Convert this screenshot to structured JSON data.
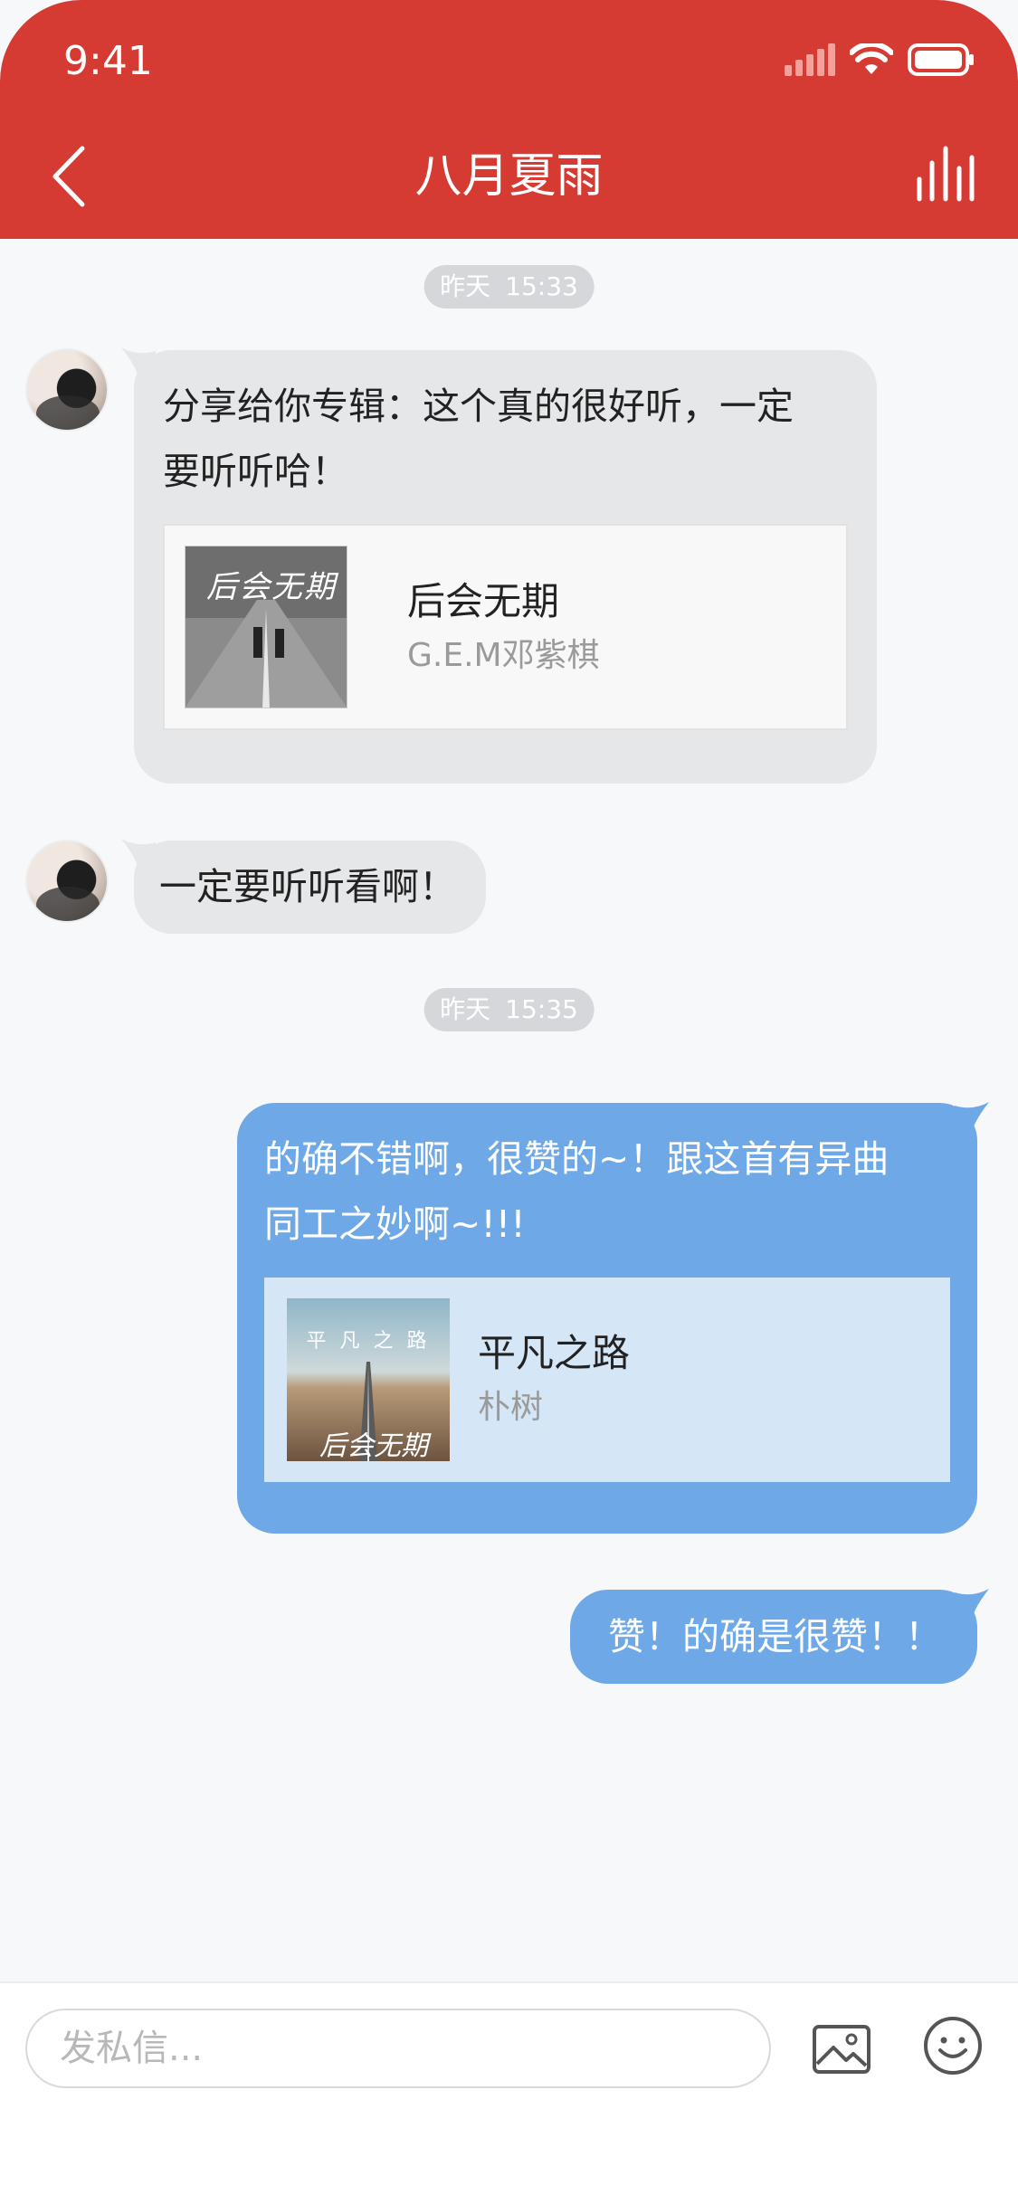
{
  "status_bar": {
    "time": "9:41"
  },
  "nav": {
    "title": "八月夏雨"
  },
  "timestamps": [
    {
      "day": "昨天",
      "time": "15:33"
    },
    {
      "day": "昨天",
      "time": "15:35"
    }
  ],
  "messages": [
    {
      "text": "分享给你专辑：这个真的很好听，一定\n要听听哈！",
      "album": {
        "title": "后会无期",
        "artist": "G.E.M邓紫棋",
        "cover_text": "后会无期"
      }
    },
    {
      "text": "一定要听听看啊！"
    },
    {
      "text": "的确不错啊，很赞的~！跟这首有异曲\n同工之妙啊~!!!",
      "album": {
        "title": "平凡之路",
        "artist": "朴树",
        "cover_text": "平 凡 之 路",
        "cover_sub": "后会无期"
      }
    },
    {
      "text": "赞！的确是很赞！！"
    }
  ],
  "composer": {
    "placeholder": "发私信..."
  },
  "colors": {
    "brand": "#d63b33",
    "bubble_self": "#6fa8e6",
    "bubble_other": "#e6e7e9"
  }
}
